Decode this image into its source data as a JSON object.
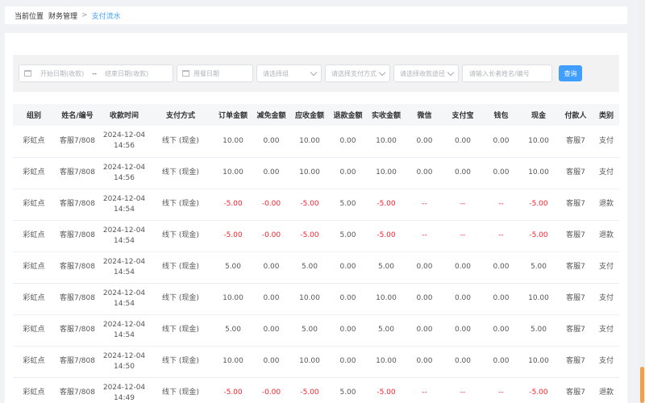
{
  "breadcrumb": {
    "prefix": "当前位置",
    "items": [
      "财务管理",
      "支付流水"
    ],
    "separator": ">"
  },
  "filters": {
    "start_date_placeholder": "开始日期(收款)",
    "range_dash": "--",
    "end_date_placeholder": "结束日期(收款)",
    "meal_date_placeholder": "用餐日期",
    "group_placeholder": "请选择组",
    "payment_method_placeholder": "请选择支付方式",
    "collection_channel_placeholder": "请选择收款途径",
    "keyword_placeholder": "请输入长者姓名/编号",
    "search_label": "查询"
  },
  "table": {
    "columns": [
      "组别",
      "姓名/编号",
      "收款时间",
      "支付方式",
      "订单金额",
      "减免金额",
      "应收金额",
      "退款金额",
      "实收金额",
      "微信",
      "支付宝",
      "钱包",
      "现金",
      "付款人",
      "类别"
    ],
    "rows": [
      {
        "cells": [
          "彩虹点",
          "客服7/808",
          "2024-12-04 14:56",
          "线下 (现金)",
          "10.00",
          "0.00",
          "10.00",
          "0.00",
          "10.00",
          "0.00",
          "0.00",
          "0.00",
          "10.00",
          "客服7",
          "支付"
        ],
        "neg": false
      },
      {
        "cells": [
          "彩虹点",
          "客服7/808",
          "2024-12-04 14:56",
          "线下 (现金)",
          "10.00",
          "0.00",
          "10.00",
          "0.00",
          "10.00",
          "0.00",
          "0.00",
          "0.00",
          "10.00",
          "客服7",
          "支付"
        ],
        "neg": false
      },
      {
        "cells": [
          "彩虹点",
          "客服7/808",
          "2024-12-04 14:54",
          "线下 (现金)",
          "-5.00",
          "-0.00",
          "-5.00",
          "5.00",
          "-5.00",
          "--",
          "--",
          "--",
          "-5.00",
          "客服7",
          "退款"
        ],
        "neg": true
      },
      {
        "cells": [
          "彩虹点",
          "客服7/808",
          "2024-12-04 14:54",
          "线下 (现金)",
          "-5.00",
          "-0.00",
          "-5.00",
          "5.00",
          "-5.00",
          "--",
          "--",
          "--",
          "-5.00",
          "客服7",
          "退款"
        ],
        "neg": true
      },
      {
        "cells": [
          "彩虹点",
          "客服7/808",
          "2024-12-04 14:54",
          "线下 (现金)",
          "5.00",
          "0.00",
          "5.00",
          "0.00",
          "5.00",
          "0.00",
          "0.00",
          "0.00",
          "5.00",
          "客服7",
          "支付"
        ],
        "neg": false
      },
      {
        "cells": [
          "彩虹点",
          "客服7/808",
          "2024-12-04 14:54",
          "线下 (现金)",
          "10.00",
          "0.00",
          "10.00",
          "0.00",
          "10.00",
          "0.00",
          "0.00",
          "0.00",
          "10.00",
          "客服7",
          "支付"
        ],
        "neg": false
      },
      {
        "cells": [
          "彩虹点",
          "客服7/808",
          "2024-12-04 14:54",
          "线下 (现金)",
          "5.00",
          "0.00",
          "5.00",
          "0.00",
          "5.00",
          "0.00",
          "0.00",
          "0.00",
          "5.00",
          "客服7",
          "支付"
        ],
        "neg": false
      },
      {
        "cells": [
          "彩虹点",
          "客服7/808",
          "2024-12-04 14:50",
          "线下 (现金)",
          "10.00",
          "0.00",
          "10.00",
          "0.00",
          "10.00",
          "0.00",
          "0.00",
          "0.00",
          "10.00",
          "客服7",
          "支付"
        ],
        "neg": false
      },
      {
        "cells": [
          "彩虹点",
          "客服7/808",
          "2024-12-04 14:49",
          "线下 (现金)",
          "-5.00",
          "-0.00",
          "-5.00",
          "5.00",
          "-5.00",
          "--",
          "--",
          "--",
          "-5.00",
          "客服7",
          "退款"
        ],
        "neg": true
      }
    ]
  },
  "colors": {
    "accent": "#409eff",
    "negative": "#f5222d",
    "scroll_thumb": "#f0a04b"
  },
  "icons": [
    "calendar-icon",
    "chevron-down-icon"
  ]
}
